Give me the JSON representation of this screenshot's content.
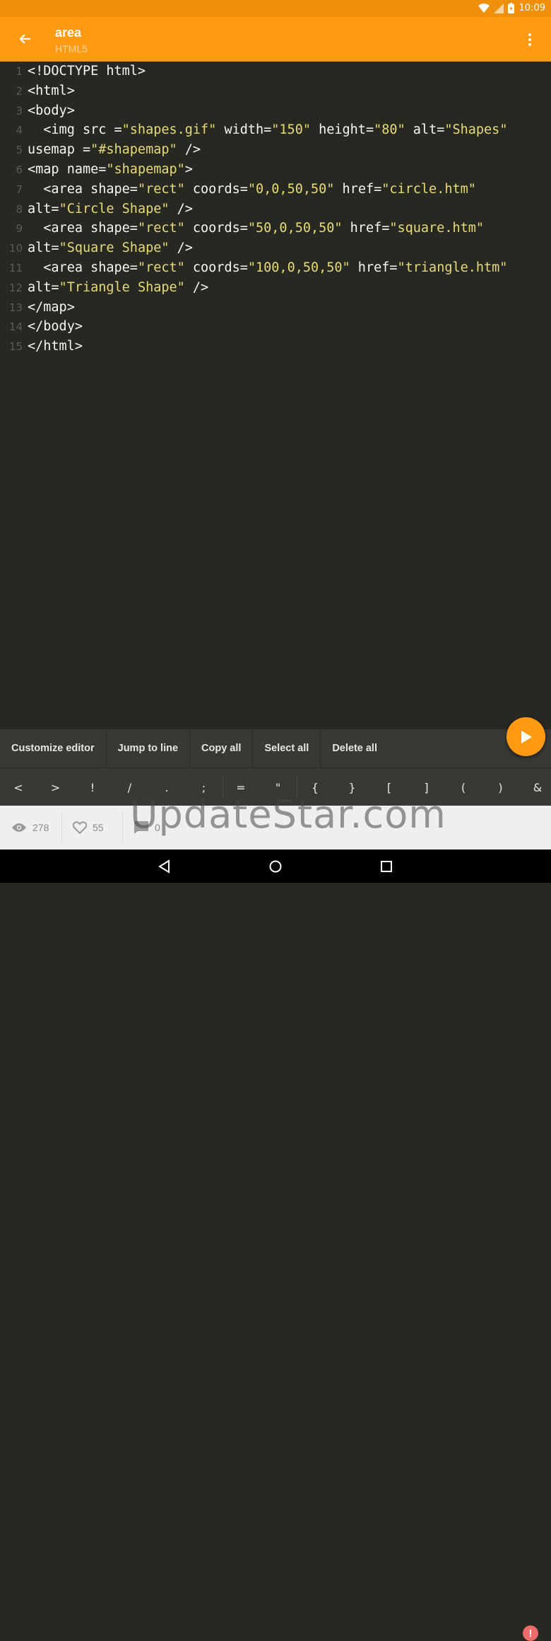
{
  "status_bar": {
    "time": "10:09"
  },
  "app_bar": {
    "title": "area",
    "subtitle": "HTML5"
  },
  "editor": {
    "lines": [
      {
        "n": "1",
        "segs": [
          {
            "t": "<!DOCTYPE html>",
            "s": false
          }
        ]
      },
      {
        "n": "2",
        "segs": [
          {
            "t": "<html>",
            "s": false
          }
        ]
      },
      {
        "n": "3",
        "segs": [
          {
            "t": "<body>",
            "s": false
          }
        ]
      },
      {
        "n": "4",
        "segs": [
          {
            "t": "  <img src =",
            "s": false
          },
          {
            "t": "\"shapes.gif\"",
            "s": true
          },
          {
            "t": " width=",
            "s": false
          },
          {
            "t": "\"150\"",
            "s": true
          },
          {
            "t": " height=",
            "s": false
          },
          {
            "t": "\"80\"",
            "s": true
          },
          {
            "t": " alt=",
            "s": false
          },
          {
            "t": "\"Shapes\"",
            "s": true
          }
        ]
      },
      {
        "n": "5",
        "segs": [
          {
            "t": "usemap =",
            "s": false
          },
          {
            "t": "\"#shapemap\"",
            "s": true
          },
          {
            "t": " />",
            "s": false
          }
        ]
      },
      {
        "n": "6",
        "segs": [
          {
            "t": "<map name=",
            "s": false
          },
          {
            "t": "\"shapemap\"",
            "s": true
          },
          {
            "t": ">",
            "s": false
          }
        ]
      },
      {
        "n": "7",
        "segs": [
          {
            "t": "  <area shape=",
            "s": false
          },
          {
            "t": "\"rect\"",
            "s": true
          },
          {
            "t": " coords=",
            "s": false
          },
          {
            "t": "\"0,0,50,50\"",
            "s": true
          },
          {
            "t": " href=",
            "s": false
          },
          {
            "t": "\"circle.htm\"",
            "s": true
          }
        ]
      },
      {
        "n": "8",
        "segs": [
          {
            "t": "alt=",
            "s": false
          },
          {
            "t": "\"Circle Shape\"",
            "s": true
          },
          {
            "t": " />",
            "s": false
          }
        ]
      },
      {
        "n": "9",
        "segs": [
          {
            "t": "  <area shape=",
            "s": false
          },
          {
            "t": "\"rect\"",
            "s": true
          },
          {
            "t": " coords=",
            "s": false
          },
          {
            "t": "\"50,0,50,50\"",
            "s": true
          },
          {
            "t": " href=",
            "s": false
          },
          {
            "t": "\"square.htm\"",
            "s": true
          }
        ]
      },
      {
        "n": "10",
        "segs": [
          {
            "t": "alt=",
            "s": false
          },
          {
            "t": "\"Square Shape\"",
            "s": true
          },
          {
            "t": " />",
            "s": false
          }
        ]
      },
      {
        "n": "11",
        "segs": [
          {
            "t": "  <area shape=",
            "s": false
          },
          {
            "t": "\"rect\"",
            "s": true
          },
          {
            "t": " coords=",
            "s": false
          },
          {
            "t": "\"100,0,50,50\"",
            "s": true
          },
          {
            "t": " href=",
            "s": false
          },
          {
            "t": "\"triangle.htm\"",
            "s": true
          }
        ]
      },
      {
        "n": "12",
        "segs": [
          {
            "t": "alt=",
            "s": false
          },
          {
            "t": "\"Triangle Shape\"",
            "s": true
          },
          {
            "t": " />",
            "s": false
          }
        ]
      },
      {
        "n": "13",
        "segs": [
          {
            "t": "</map>",
            "s": false
          }
        ]
      },
      {
        "n": "14",
        "segs": [
          {
            "t": "</body>",
            "s": false
          }
        ]
      },
      {
        "n": "15",
        "segs": [
          {
            "t": "</html>",
            "s": false
          }
        ]
      }
    ]
  },
  "toolbar": {
    "customize": "Customize editor",
    "jump": "Jump to line",
    "copy": "Copy all",
    "select": "Select all",
    "delete": "Delete all"
  },
  "symbols": [
    "<",
    ">",
    "!",
    "/",
    ".",
    ";",
    "=",
    "\"",
    "{",
    "}",
    "[",
    "]",
    "(",
    ")",
    "&"
  ],
  "stats": {
    "views": "278",
    "likes": "55",
    "comments": "0"
  },
  "watermark": "UpdateStar.com",
  "error_badge": "!",
  "colors": {
    "accent": "#ff9a12",
    "editor_bg": "#272822",
    "string": "#e6db74"
  }
}
